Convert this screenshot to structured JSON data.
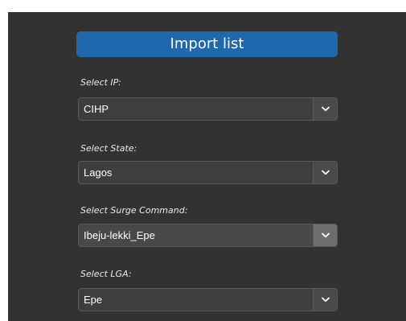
{
  "header": {
    "import_label": "Import list"
  },
  "fields": [
    {
      "label": "Select IP:",
      "value": "CIHP"
    },
    {
      "label": "Select State:",
      "value": "Lagos"
    },
    {
      "label": "Select Surge Command:",
      "value": "Ibeju-lekki_Epe"
    },
    {
      "label": "Select LGA:",
      "value": "Epe"
    }
  ],
  "icons": {
    "dropdown": "chevron-down-icon"
  },
  "colors": {
    "panel_bg": "#323232",
    "primary_button": "#1e69ad",
    "text": "#ffffff"
  }
}
